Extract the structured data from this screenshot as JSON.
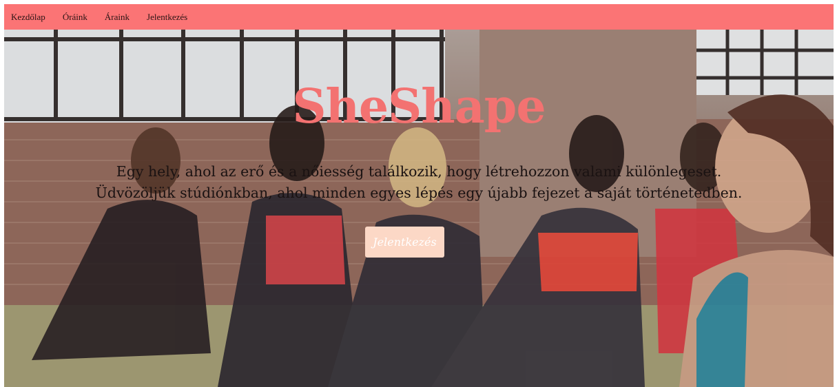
{
  "nav": {
    "items": [
      {
        "label": "Kezdőlap"
      },
      {
        "label": "Óráink"
      },
      {
        "label": "Áraink"
      },
      {
        "label": "Jelentkezés"
      }
    ]
  },
  "hero": {
    "title": "SheShape",
    "lines": [
      "Egy hely, ahol az erő és a nőiesség találkozik, hogy létrehozzon valami különlegeset.",
      "Üdvözöljük stúdiónkban, ahol minden egyes lépés egy újabb fejezet a saját történetedben."
    ],
    "cta_label": "Jelentkezés"
  },
  "colors": {
    "nav_bg": "#fb7475",
    "title": "#f37271",
    "cta_bg": "#fcd8c6"
  }
}
